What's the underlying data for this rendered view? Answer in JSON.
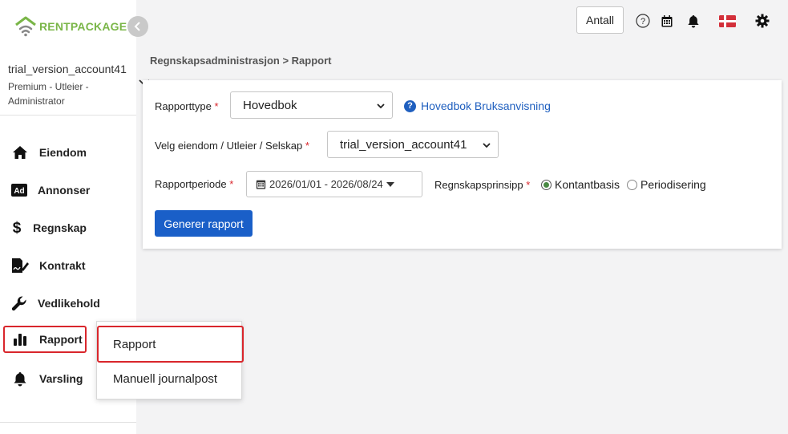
{
  "brand": {
    "name_part1": "RENT",
    "name_part2": "PACKAGE",
    "color": "#7ab648"
  },
  "account": {
    "name": "trial_version_account41",
    "role_line1": "Premium - Utleier -",
    "role_line2": "Administrator"
  },
  "sidebar": {
    "items": [
      {
        "label": "Eiendom",
        "icon": "home-icon"
      },
      {
        "label": "Annonser",
        "icon": "ad-icon"
      },
      {
        "label": "Regnskap",
        "icon": "dollar-icon"
      },
      {
        "label": "Kontrakt",
        "icon": "contract-sign-icon"
      },
      {
        "label": "Vedlikehold",
        "icon": "wrench-icon"
      },
      {
        "label": "Rapport",
        "icon": "bar-chart-icon"
      },
      {
        "label": "Varsling",
        "icon": "bell-icon"
      }
    ],
    "active": "Rapport"
  },
  "submenu": {
    "items": [
      {
        "label": "Rapport"
      },
      {
        "label": "Manuell journalpost"
      }
    ]
  },
  "topbar": {
    "antall_label": "Antall",
    "icons": [
      "help-circle-icon",
      "calendar-icon",
      "bell-icon",
      "danish-flag-icon",
      "gear-icon"
    ]
  },
  "breadcrumb": "Regnskapsadministrasjon > Rapport",
  "form": {
    "rapporttype_label": "Rapporttype",
    "rapporttype_value": "Hovedbok",
    "help_link": "Hovedbok Bruksanvisning",
    "eiendom_label": "Velg eiendom / Utleier / Selskap",
    "eiendom_value": "trial_version_account41",
    "periode_label": "Rapportperiode",
    "periode_value": "2026/01/01 - 2026/08/24",
    "prinsipp_label": "Regnskapsprinsipp",
    "prinsipp_options": [
      "Kontantbasis",
      "Periodisering"
    ],
    "prinsipp_selected": "Kontantbasis",
    "required_mark": "*",
    "generate_button": "Generer rapport"
  },
  "colors": {
    "primary": "#1a5fc8",
    "link": "#1f5fbf",
    "required": "#d9262c",
    "highlight_border": "#d9262c",
    "radio_checked": "#4a8a44"
  }
}
